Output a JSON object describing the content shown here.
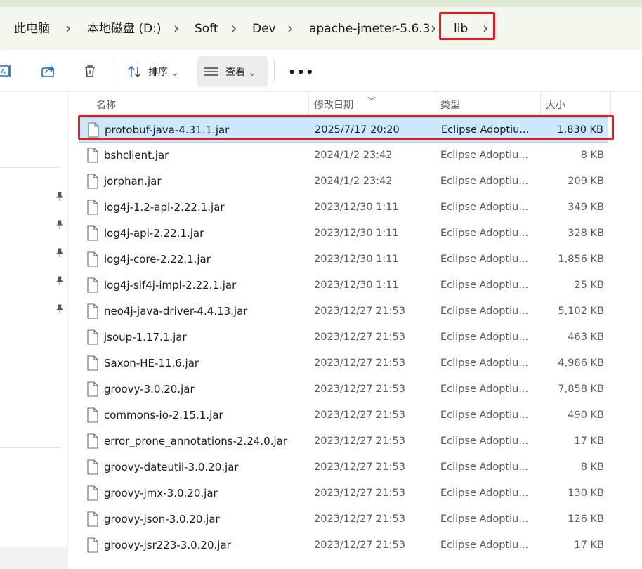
{
  "breadcrumb": {
    "items": [
      "此电脑",
      "本地磁盘 (D:)",
      "Soft",
      "Dev",
      "apache-jmeter-5.6.3",
      "lib"
    ]
  },
  "toolbar": {
    "sort_label": "排序",
    "view_label": "查看",
    "more_label": "•••",
    "icons": [
      "rename-icon",
      "share-icon",
      "delete-icon",
      "sort-icon",
      "view-icon",
      "more-icon"
    ]
  },
  "columns": {
    "name": "名称",
    "date": "修改日期",
    "type": "类型",
    "size": "大小"
  },
  "files": [
    {
      "name": "protobuf-java-4.31.1.jar",
      "date": "2025/7/17 20:20",
      "type": "Eclipse Adoptiu...",
      "size": "1,830 KB",
      "selected": true
    },
    {
      "name": "bshclient.jar",
      "date": "2024/1/2 23:42",
      "type": "Eclipse Adoptiu...",
      "size": "8 KB"
    },
    {
      "name": "jorphan.jar",
      "date": "2024/1/2 23:42",
      "type": "Eclipse Adoptiu...",
      "size": "209 KB"
    },
    {
      "name": "log4j-1.2-api-2.22.1.jar",
      "date": "2023/12/30 1:11",
      "type": "Eclipse Adoptiu...",
      "size": "349 KB"
    },
    {
      "name": "log4j-api-2.22.1.jar",
      "date": "2023/12/30 1:11",
      "type": "Eclipse Adoptiu...",
      "size": "328 KB"
    },
    {
      "name": "log4j-core-2.22.1.jar",
      "date": "2023/12/30 1:11",
      "type": "Eclipse Adoptiu...",
      "size": "1,856 KB"
    },
    {
      "name": "log4j-slf4j-impl-2.22.1.jar",
      "date": "2023/12/30 1:11",
      "type": "Eclipse Adoptiu...",
      "size": "25 KB"
    },
    {
      "name": "neo4j-java-driver-4.4.13.jar",
      "date": "2023/12/27 21:53",
      "type": "Eclipse Adoptiu...",
      "size": "5,102 KB"
    },
    {
      "name": "jsoup-1.17.1.jar",
      "date": "2023/12/27 21:53",
      "type": "Eclipse Adoptiu...",
      "size": "463 KB"
    },
    {
      "name": "Saxon-HE-11.6.jar",
      "date": "2023/12/27 21:53",
      "type": "Eclipse Adoptiu...",
      "size": "4,986 KB"
    },
    {
      "name": "groovy-3.0.20.jar",
      "date": "2023/12/27 21:53",
      "type": "Eclipse Adoptiu...",
      "size": "7,858 KB"
    },
    {
      "name": "commons-io-2.15.1.jar",
      "date": "2023/12/27 21:53",
      "type": "Eclipse Adoptiu...",
      "size": "490 KB"
    },
    {
      "name": "error_prone_annotations-2.24.0.jar",
      "date": "2023/12/27 21:53",
      "type": "Eclipse Adoptiu...",
      "size": "17 KB"
    },
    {
      "name": "groovy-dateutil-3.0.20.jar",
      "date": "2023/12/27 21:53",
      "type": "Eclipse Adoptiu...",
      "size": "8 KB"
    },
    {
      "name": "groovy-jmx-3.0.20.jar",
      "date": "2023/12/27 21:53",
      "type": "Eclipse Adoptiu...",
      "size": "130 KB"
    },
    {
      "name": "groovy-json-3.0.20.jar",
      "date": "2023/12/27 21:53",
      "type": "Eclipse Adoptiu...",
      "size": "126 KB"
    },
    {
      "name": "groovy-jsr223-3.0.20.jar",
      "date": "2023/12/27 21:53",
      "type": "Eclipse Adoptiu...",
      "size": "17 KB"
    }
  ],
  "colors": {
    "selection_bg": "#cce8ff",
    "selection_border": "#99d1ff",
    "annotation_red": "#e8191f",
    "address_bg": "#f3f7ee"
  }
}
